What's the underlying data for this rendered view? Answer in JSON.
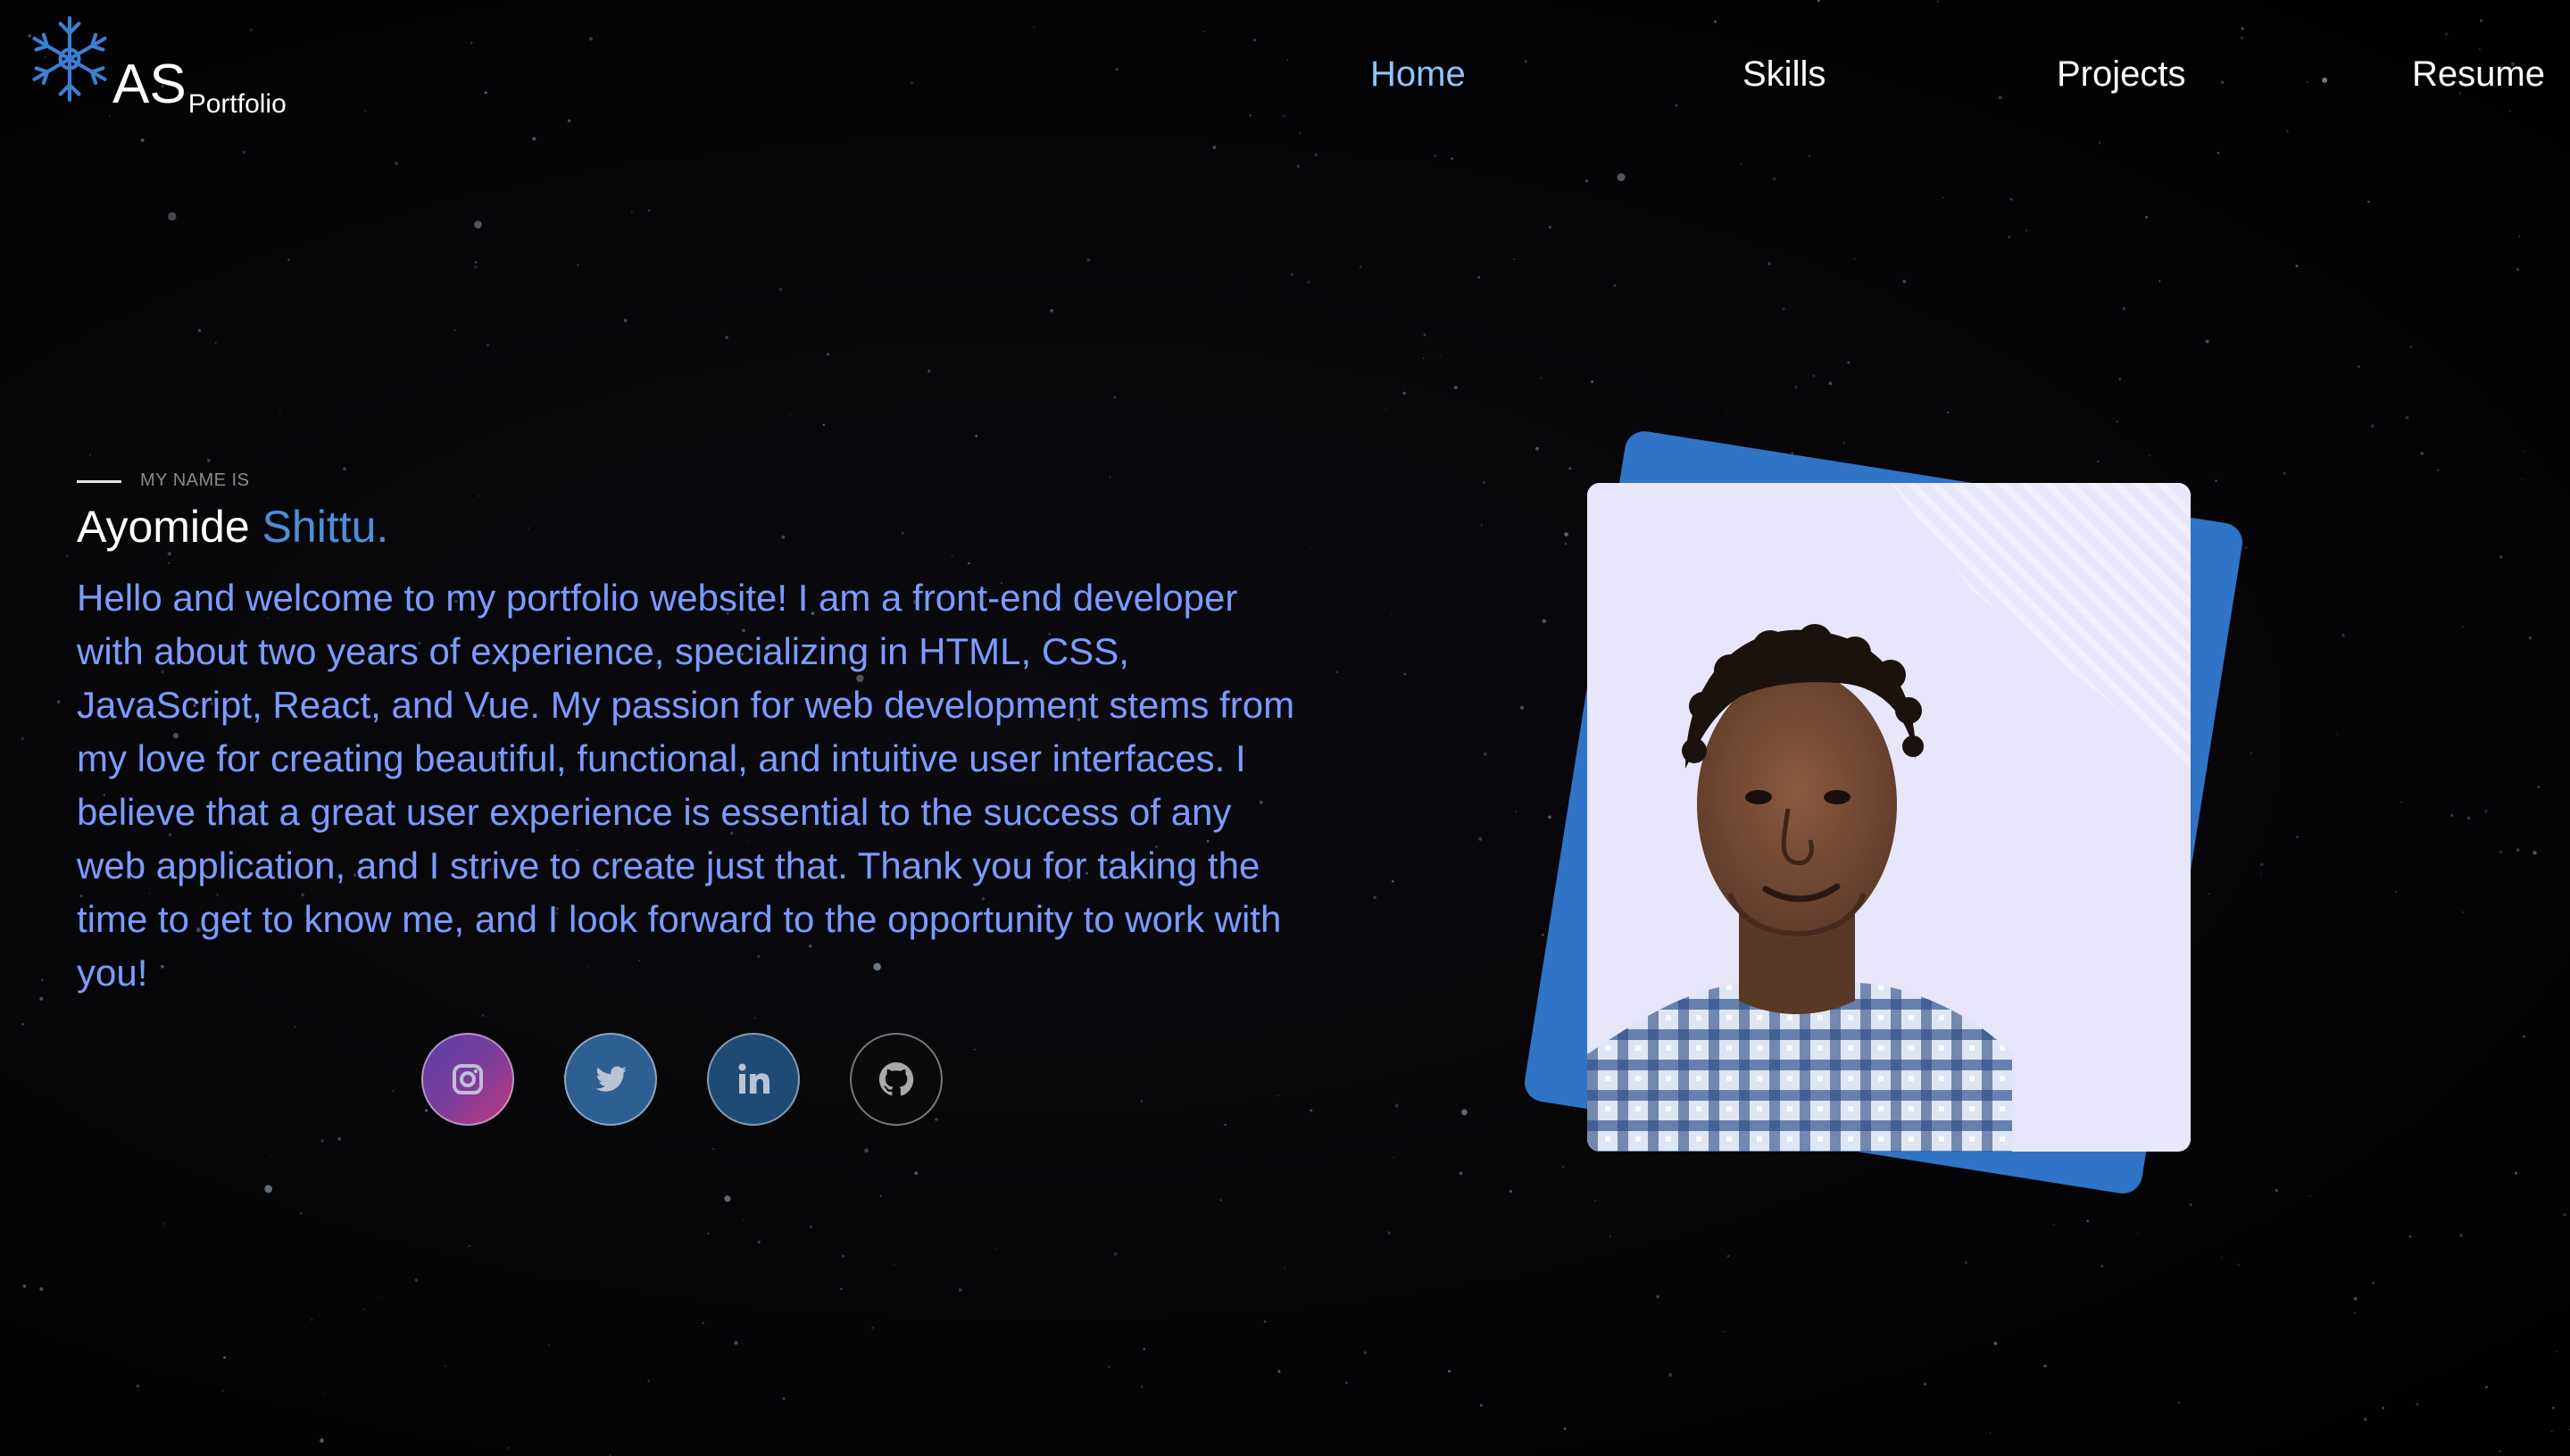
{
  "header": {
    "logo_initials": "AS",
    "logo_subtitle": "Portfolio",
    "logo_icon": "snowflake-icon",
    "nav": [
      {
        "label": "Home",
        "active": true
      },
      {
        "label": "Skills",
        "active": false
      },
      {
        "label": "Projects",
        "active": false
      },
      {
        "label": "Resume",
        "active": false
      }
    ]
  },
  "hero": {
    "intro_label": "MY NAME IS",
    "first_name": "Ayomide",
    "last_name": "Shittu.",
    "bio": "Hello and welcome to my portfolio website! I am a front-end developer with about two years of experience, specializing in HTML, CSS, JavaScript, React, and Vue. My passion for web development stems from my love for creating beautiful, functional, and intuitive user interfaces. I believe that a great user experience is essential to the success of any web application, and I strive to create just that. Thank you for taking the time to get to know me, and I look forward to the opportunity to work with you!",
    "socials": [
      {
        "name": "instagram",
        "icon": "instagram-icon"
      },
      {
        "name": "twitter",
        "icon": "twitter-icon"
      },
      {
        "name": "linkedin",
        "icon": "linkedin-icon"
      },
      {
        "name": "github",
        "icon": "github-icon"
      }
    ]
  },
  "colors": {
    "accent": "#4d8ed9",
    "active_nav": "#8ec6ff",
    "bio_text": "#7c9bff",
    "photo_backdrop": "#2f74c6",
    "photo_card": "#e7e6fa",
    "background": "#000000"
  }
}
